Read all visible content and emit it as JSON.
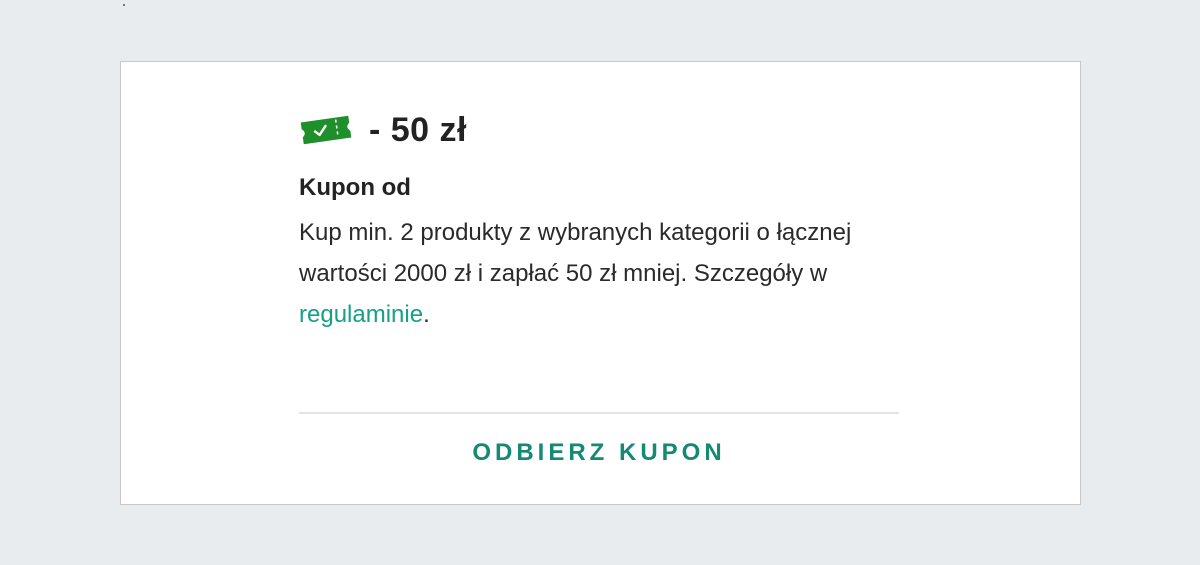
{
  "coupon": {
    "icon": "ticket-check-icon",
    "icon_color": "#1f8f2c",
    "amount": "- 50 zł",
    "title": "Kupon od",
    "description_part1": "Kup min. 2 produkty z wybranych kategorii o łącznej wartości 2000 zł i zapłać 50 zł mniej. Szczegóły w ",
    "terms_link_label": "regulaminie",
    "description_end": ".",
    "link_color": "#16a085",
    "cta_label": "ODBIERZ KUPON",
    "cta_color": "#148a73"
  }
}
